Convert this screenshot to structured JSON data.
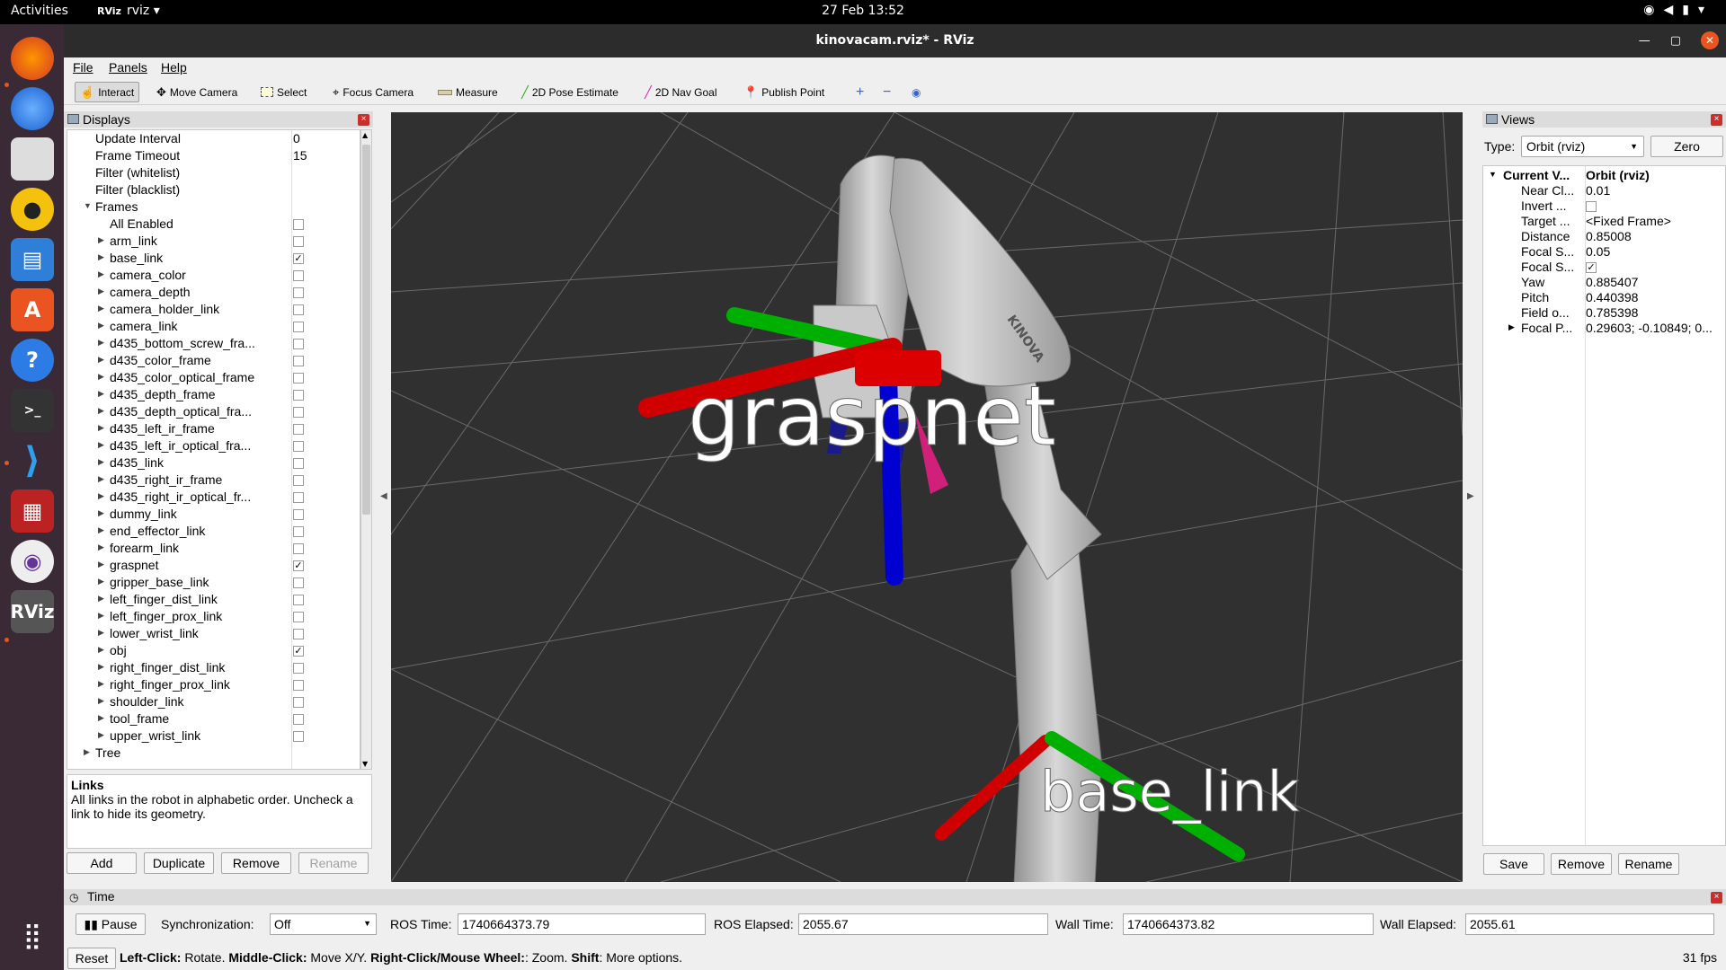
{
  "topbar": {
    "activities": "Activities",
    "app_name": "rviz",
    "app_icon_text": "RViz",
    "clock": "27 Feb  13:52"
  },
  "window": {
    "title": "kinovacam.rviz* - RViz"
  },
  "menu": {
    "file": "File",
    "panels": "Panels",
    "help": "Help"
  },
  "toolbar": {
    "interact": "Interact",
    "move_camera": "Move Camera",
    "select": "Select",
    "focus_camera": "Focus Camera",
    "measure": "Measure",
    "pose_estimate": "2D Pose Estimate",
    "nav_goal": "2D Nav Goal",
    "publish_point": "Publish Point"
  },
  "displays": {
    "title": "Displays",
    "props": [
      {
        "label": "Update Interval",
        "value": "0"
      },
      {
        "label": "Frame Timeout",
        "value": "15"
      },
      {
        "label": "Filter (whitelist)",
        "value": ""
      },
      {
        "label": "Filter (blacklist)",
        "value": ""
      }
    ],
    "frames_label": "Frames",
    "all_enabled": "All Enabled",
    "frames": [
      {
        "name": "arm_link",
        "checked": false
      },
      {
        "name": "base_link",
        "checked": true
      },
      {
        "name": "camera_color",
        "checked": false
      },
      {
        "name": "camera_depth",
        "checked": false
      },
      {
        "name": "camera_holder_link",
        "checked": false
      },
      {
        "name": "camera_link",
        "checked": false
      },
      {
        "name": "d435_bottom_screw_fra...",
        "checked": false
      },
      {
        "name": "d435_color_frame",
        "checked": false
      },
      {
        "name": "d435_color_optical_frame",
        "checked": false
      },
      {
        "name": "d435_depth_frame",
        "checked": false
      },
      {
        "name": "d435_depth_optical_fra...",
        "checked": false
      },
      {
        "name": "d435_left_ir_frame",
        "checked": false
      },
      {
        "name": "d435_left_ir_optical_fra...",
        "checked": false
      },
      {
        "name": "d435_link",
        "checked": false
      },
      {
        "name": "d435_right_ir_frame",
        "checked": false
      },
      {
        "name": "d435_right_ir_optical_fr...",
        "checked": false
      },
      {
        "name": "dummy_link",
        "checked": false
      },
      {
        "name": "end_effector_link",
        "checked": false
      },
      {
        "name": "forearm_link",
        "checked": false
      },
      {
        "name": "graspnet",
        "checked": true
      },
      {
        "name": "gripper_base_link",
        "checked": false
      },
      {
        "name": "left_finger_dist_link",
        "checked": false
      },
      {
        "name": "left_finger_prox_link",
        "checked": false
      },
      {
        "name": "lower_wrist_link",
        "checked": false
      },
      {
        "name": "obj",
        "checked": true
      },
      {
        "name": "right_finger_dist_link",
        "checked": false
      },
      {
        "name": "right_finger_prox_link",
        "checked": false
      },
      {
        "name": "shoulder_link",
        "checked": false
      },
      {
        "name": "tool_frame",
        "checked": false
      },
      {
        "name": "upper_wrist_link",
        "checked": false
      }
    ],
    "tree_label": "Tree",
    "desc_title": "Links",
    "desc_text": "All links in the robot in alphabetic order. Uncheck a link to hide its geometry.",
    "buttons": {
      "add": "Add",
      "duplicate": "Duplicate",
      "remove": "Remove",
      "rename": "Rename"
    }
  },
  "viewport": {
    "label_graspnet": "graspnet",
    "label_base_link": "base_link",
    "robot_text": "KINOVA"
  },
  "views": {
    "title": "Views",
    "type_label": "Type:",
    "type_value": "Orbit (rviz)",
    "zero": "Zero",
    "current_key": "Current V...",
    "current_val": "Orbit (rviz)",
    "props": [
      {
        "k": "Near Cl...",
        "v": "0.01"
      },
      {
        "k": "Invert ...",
        "v": ""
      },
      {
        "k": "Target ...",
        "v": "<Fixed Frame>"
      },
      {
        "k": "Distance",
        "v": "0.85008"
      },
      {
        "k": "Focal S...",
        "v": "0.05"
      },
      {
        "k": "Focal S...",
        "v": ""
      },
      {
        "k": "Yaw",
        "v": "0.885407"
      },
      {
        "k": "Pitch",
        "v": "0.440398"
      },
      {
        "k": "Field o...",
        "v": "0.785398"
      },
      {
        "k": "Focal P...",
        "v": "0.29603; -0.10849; 0..."
      }
    ],
    "invert_checked": false,
    "focal_checked": true,
    "buttons": {
      "save": "Save",
      "remove": "Remove",
      "rename": "Rename"
    }
  },
  "time": {
    "title": "Time",
    "pause": "Pause",
    "sync_label": "Synchronization:",
    "sync_value": "Off",
    "ros_time_label": "ROS Time:",
    "ros_time": "1740664373.79",
    "ros_elapsed_label": "ROS Elapsed:",
    "ros_elapsed": "2055.67",
    "wall_time_label": "Wall Time:",
    "wall_time": "1740664373.82",
    "wall_elapsed_label": "Wall Elapsed:",
    "wall_elapsed": "2055.61"
  },
  "status": {
    "reset": "Reset",
    "hint_1b": "Left-Click:",
    "hint_1": " Rotate. ",
    "hint_2b": "Middle-Click:",
    "hint_2": " Move X/Y. ",
    "hint_3b": "Right-Click/Mouse Wheel:",
    "hint_3": ": Zoom. ",
    "hint_4b": "Shift",
    "hint_4": ": More options.",
    "fps": "31 fps"
  },
  "colors": {
    "accent": "#e95420",
    "x_axis": "#cc0000",
    "y_axis": "#00cc00",
    "z_axis": "#0000cc"
  }
}
